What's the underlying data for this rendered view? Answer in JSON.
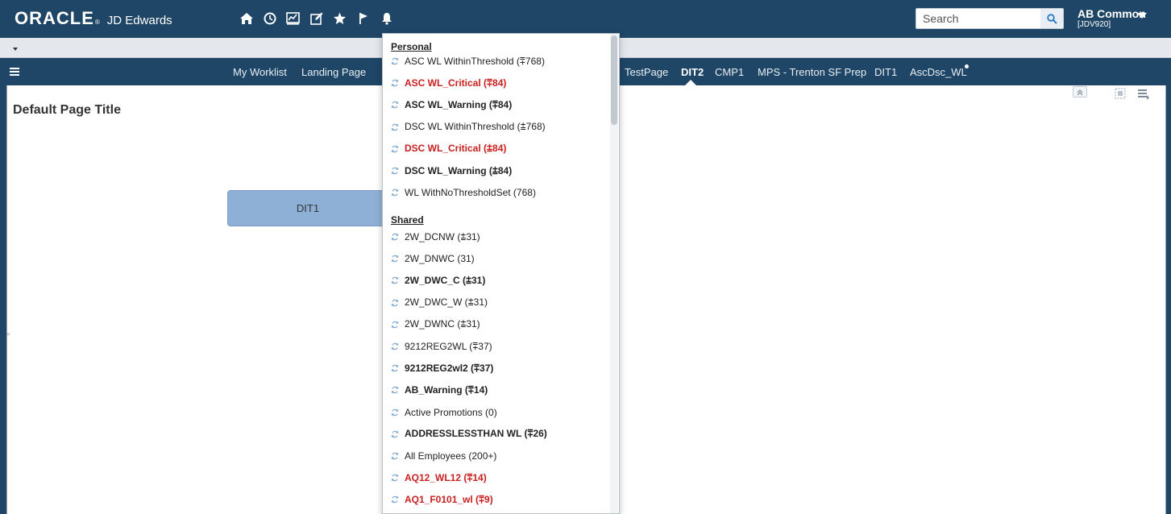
{
  "header": {
    "logo": {
      "brand": "ORACLE",
      "product": "JD Edwards"
    },
    "icons": [
      {
        "name": "home-icon"
      },
      {
        "name": "recent-icon"
      },
      {
        "name": "analytics-icon"
      },
      {
        "name": "edit-icon"
      },
      {
        "name": "star-icon"
      },
      {
        "name": "flag-icon"
      },
      {
        "name": "bell-icon"
      }
    ],
    "search": {
      "placeholder": "Search"
    },
    "user": {
      "name": "AB Common",
      "environment": "[JDV920]"
    }
  },
  "nav": {
    "items": [
      "My Worklist",
      "Landing Page",
      "TestPage",
      "DIT2",
      "CMP1",
      "MPS - Trenton SF Prep",
      "DIT1",
      "AscDsc_WL"
    ],
    "active": "DIT2"
  },
  "main": {
    "page_title": "Default Page Title",
    "tile": "DIT1"
  },
  "dropdown": {
    "personal_heading": "Personal",
    "personal": [
      {
        "label": "ASC WL WithinThreshold (⩱768)",
        "style": "normal"
      },
      {
        "label": "ASC WL_Critical (⩱84)",
        "style": "critical"
      },
      {
        "label": "ASC WL_Warning (⩱84)",
        "style": "bold"
      },
      {
        "label": "DSC WL WithinThreshold (⩲768)",
        "style": "normal"
      },
      {
        "label": "DSC WL_Critical (⩲84)",
        "style": "critical"
      },
      {
        "label": "DSC WL_Warning (⩲84)",
        "style": "bold"
      },
      {
        "label": "WL WithNoThresholdSet (768)",
        "style": "normal"
      }
    ],
    "shared_heading": "Shared",
    "shared": [
      {
        "label": "2W_DCNW (⩲31)",
        "style": "normal"
      },
      {
        "label": "2W_DNWC (31)",
        "style": "normal"
      },
      {
        "label": "2W_DWC_C (⩲31)",
        "style": "bold"
      },
      {
        "label": "2W_DWC_W (⩲31)",
        "style": "normal"
      },
      {
        "label": "2W_DWNC (⩲31)",
        "style": "normal"
      },
      {
        "label": "9212REG2WL (⩱37)",
        "style": "normal"
      },
      {
        "label": "9212REG2wl2 (⩱37)",
        "style": "bold"
      },
      {
        "label": "AB_Warning (⩱14)",
        "style": "bold"
      },
      {
        "label": "Active Promotions (0)",
        "style": "normal"
      },
      {
        "label": "ADDRESSLESSTHAN WL (⩱26)",
        "style": "bold"
      },
      {
        "label": "All Employees (200+)",
        "style": "normal"
      },
      {
        "label": "AQ12_WL12 (⩱14)",
        "style": "critical"
      },
      {
        "label": "AQ1_F0101_wl (⩱9)",
        "style": "critical"
      }
    ]
  },
  "colors": {
    "header_bg": "#1f4666",
    "critical": "#c91f1f",
    "tile": "#8fb0d6"
  }
}
